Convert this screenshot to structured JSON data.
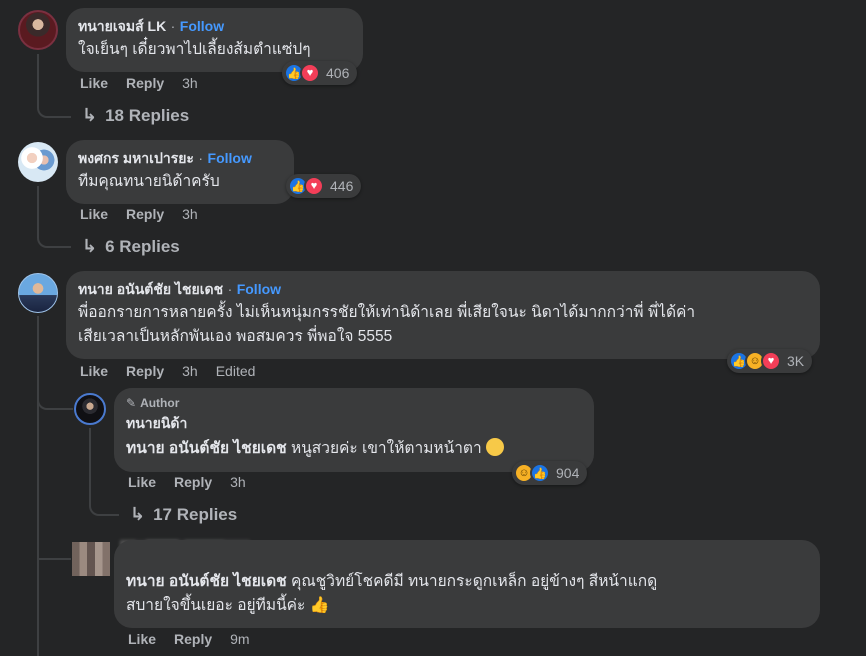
{
  "comments": [
    {
      "name": "ทนายเจมส์ LK",
      "follow": "Follow",
      "text": "ใจเย็นๆ เดี๋ยวพาไปเลี้ยงส้มตำแซ่ปๆ",
      "like": "Like",
      "reply": "Reply",
      "time": "3h",
      "reaction_count": "406",
      "replies": "18 Replies"
    },
    {
      "name": "พงศกร มหาเปารยะ",
      "follow": "Follow",
      "text": "ทีมคุณทนายนิด้าครับ",
      "like": "Like",
      "reply": "Reply",
      "time": "3h",
      "reaction_count": "446",
      "replies": "6 Replies"
    },
    {
      "name": "ทนาย อนันต์ชัย ไชยเดช",
      "follow": "Follow",
      "text_line1": "พี่ออกรายการหลายครั้ง ไม่เห็นหนุ่มกรรชัยให้เท่านิด้าเลย พี่เสียใจนะ นิดาได้มากกว่าพี่ พี่ได้ค่า",
      "text_line2": "เสียเวลาเป็นหลักพันเอง พอสมควร พี่พอใจ 5555",
      "like": "Like",
      "reply": "Reply",
      "time": "3h",
      "edited": "Edited",
      "reaction_count": "3K"
    }
  ],
  "reply_author": {
    "badge": "Author",
    "name": "ทนายนิด้า",
    "mention": "ทนาย อนันต์ชัย ไชยเดช",
    "text": "หนูสวยค่ะ เขาให้ตามหน้าตา",
    "like": "Like",
    "reply": "Reply",
    "time": "3h",
    "reaction_count": "904",
    "replies": "17 Replies"
  },
  "reply_last": {
    "mention": "ทนาย อนันต์ชัย ไชยเดช",
    "text_line1": "คุณชูวิทย์โชคดีมี ทนายกระดูกเหล็ก อยู่ข้างๆ สีหน้าแกดู",
    "text_line2": "สบายใจขึ้นเยอะ อยู่ทีมนี้ค่ะ",
    "like": "Like",
    "reply": "Reply",
    "time": "9m"
  },
  "colors": {
    "background": "#242526",
    "bubble": "#3a3b3c",
    "link": "#4599ff",
    "like": "#1b74e4",
    "love": "#f33e58",
    "haha": "#f7b125"
  }
}
